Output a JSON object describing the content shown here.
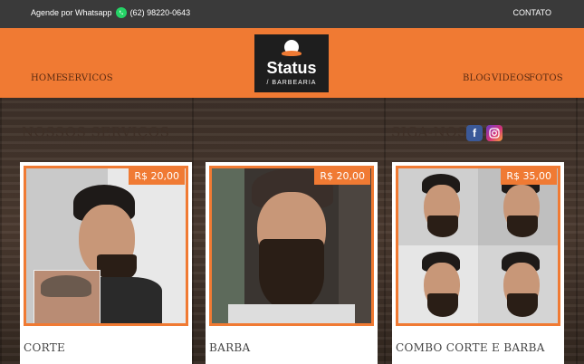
{
  "topbar": {
    "whatsapp_text": "Agende por Whatsapp",
    "phone": "(62) 98220-0643",
    "contact": "CONTATO"
  },
  "nav": {
    "home": "HOME",
    "services": "SERVICOS",
    "blog": "BLOG",
    "videos": "VIDEOS",
    "photos": "FOTOS"
  },
  "logo": {
    "name": "Status",
    "sub": "/ BARBEARIA"
  },
  "sections": {
    "services_title": "NOSSOS SERVIÇOS",
    "social_title": "SIGA-NOS"
  },
  "cards": [
    {
      "price": "R$ 20,00",
      "title": "CORTE"
    },
    {
      "price": "R$ 20,00",
      "title": "BARBA"
    },
    {
      "price": "R$ 35,00",
      "title": "COMBO CORTE E BARBA"
    }
  ],
  "colors": {
    "accent": "#f07a33",
    "topbar": "#3a3a3a",
    "whatsapp": "#25d366"
  },
  "icons": [
    "whatsapp-icon",
    "facebook-icon",
    "instagram-icon"
  ]
}
